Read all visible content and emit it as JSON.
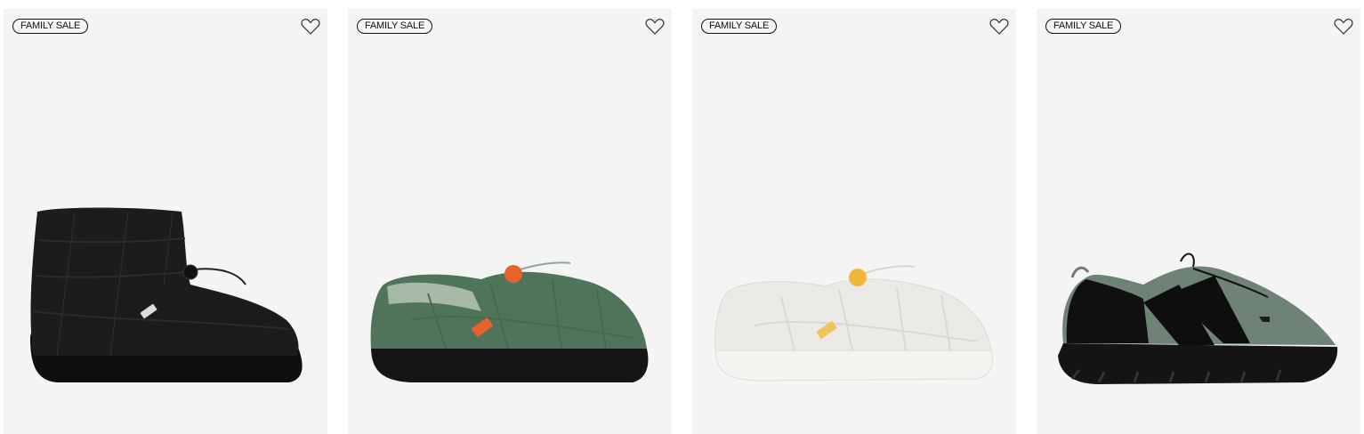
{
  "products": [
    {
      "badge": "FAMILY SALE",
      "wishlist_icon": "heart-outline-icon",
      "image_subject": "black quilted ankle bootie",
      "colors": {
        "upper": "#1b1b1b",
        "sole": "#0f0f0f",
        "accent": "#2a2a2a"
      }
    },
    {
      "badge": "FAMILY SALE",
      "wishlist_icon": "heart-outline-icon",
      "image_subject": "green quilted mule with orange toggle",
      "colors": {
        "upper": "#4f7459",
        "sole": "#151515",
        "accent": "#e8632b"
      }
    },
    {
      "badge": "FAMILY SALE",
      "wishlist_icon": "heart-outline-icon",
      "image_subject": "off-white quilted mule with yellow toggle",
      "colors": {
        "upper": "#ecebe6",
        "sole": "#f4f3ef",
        "accent": "#f2b63c"
      }
    },
    {
      "badge": "FAMILY SALE",
      "wishlist_icon": "heart-outline-icon",
      "image_subject": "sage and black slip-on trail shoe",
      "colors": {
        "upper": "#6f8276",
        "sole": "#141414",
        "accent": "#0e0e0e"
      }
    }
  ]
}
